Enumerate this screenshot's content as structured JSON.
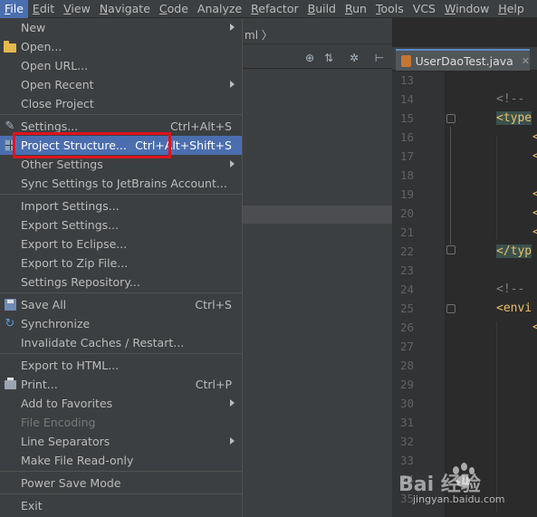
{
  "menubar": {
    "items": [
      {
        "label": "File",
        "underline": "F",
        "rest": "ile"
      },
      {
        "label": "Edit",
        "underline": "E",
        "rest": "dit"
      },
      {
        "label": "View",
        "underline": "V",
        "rest": "iew"
      },
      {
        "label": "Navigate",
        "underline": "N",
        "rest": "avigate"
      },
      {
        "label": "Code",
        "underline": "C",
        "rest": "ode"
      },
      {
        "label": "Analyze",
        "underline": "",
        "rest": "Analyze"
      },
      {
        "label": "Refactor",
        "underline": "R",
        "rest": "efactor"
      },
      {
        "label": "Build",
        "underline": "B",
        "rest": "uild"
      },
      {
        "label": "Run",
        "underline": "R",
        "rest": "un"
      },
      {
        "label": "Tools",
        "underline": "T",
        "rest": "ools"
      },
      {
        "label": "VCS",
        "underline": "",
        "rest": "VCS"
      },
      {
        "label": "Window",
        "underline": "W",
        "rest": "indow"
      },
      {
        "label": "Help",
        "underline": "H",
        "rest": "elp"
      }
    ]
  },
  "breadcrumb": "ml 〉",
  "file_menu": {
    "items": [
      {
        "label": "New",
        "shortcut": "",
        "submenu": true
      },
      {
        "label": "Open...",
        "shortcut": "",
        "icon": "folder-icon"
      },
      {
        "label": "Open URL...",
        "shortcut": ""
      },
      {
        "label": "Open Recent",
        "shortcut": "",
        "submenu": true
      },
      {
        "label": "Close Project",
        "shortcut": ""
      },
      {
        "label": "Settings...",
        "shortcut": "Ctrl+Alt+S",
        "icon": "wrench-icon"
      },
      {
        "label": "Project Structure...",
        "shortcut": "Ctrl+Alt+Shift+S",
        "icon": "project-structure-icon"
      },
      {
        "label": "Other Settings",
        "shortcut": "",
        "submenu": true
      },
      {
        "label": "Sync Settings to JetBrains Account...",
        "shortcut": ""
      },
      {
        "label": "Import Settings...",
        "shortcut": ""
      },
      {
        "label": "Export Settings...",
        "shortcut": ""
      },
      {
        "label": "Export to Eclipse...",
        "shortcut": ""
      },
      {
        "label": "Export to Zip File...",
        "shortcut": ""
      },
      {
        "label": "Settings Repository...",
        "shortcut": ""
      },
      {
        "label": "Save All",
        "shortcut": "Ctrl+S",
        "icon": "save-icon"
      },
      {
        "label": "Synchronize",
        "shortcut": "",
        "icon": "sync-icon"
      },
      {
        "label": "Invalidate Caches / Restart...",
        "shortcut": ""
      },
      {
        "label": "Export to HTML...",
        "shortcut": ""
      },
      {
        "label": "Print...",
        "shortcut": "Ctrl+P",
        "icon": "printer-icon"
      },
      {
        "label": "Add to Favorites",
        "shortcut": "",
        "submenu": true
      },
      {
        "label": "File Encoding",
        "shortcut": "",
        "disabled": true
      },
      {
        "label": "Line Separators",
        "shortcut": "",
        "submenu": true
      },
      {
        "label": "Make File Read-only",
        "shortcut": ""
      },
      {
        "label": "Power Save Mode",
        "shortcut": ""
      },
      {
        "label": "Exit",
        "shortcut": ""
      }
    ]
  },
  "editor": {
    "tab_label": "UserDaoTest.java",
    "line_numbers": [
      "13",
      "14",
      "15",
      "16",
      "17",
      "18",
      "19",
      "20",
      "21",
      "22",
      "23",
      "24",
      "25",
      "26",
      "27",
      "28",
      "29",
      "30",
      "31",
      "32",
      "33",
      "34",
      "35"
    ],
    "code_lines": {
      "l14": "<!--",
      "l15": "<type",
      "l22": "</typ",
      "l24": "<!--",
      "l25": "<envi"
    }
  },
  "watermark": {
    "main": "Bai  经验",
    "sub": "jingyan.baidu.com"
  },
  "colors": {
    "menu_bg": "#3c3f41",
    "selection": "#4b6eaf",
    "highlight_box": "#e0131f",
    "editor_bg": "#2b2b2b"
  }
}
